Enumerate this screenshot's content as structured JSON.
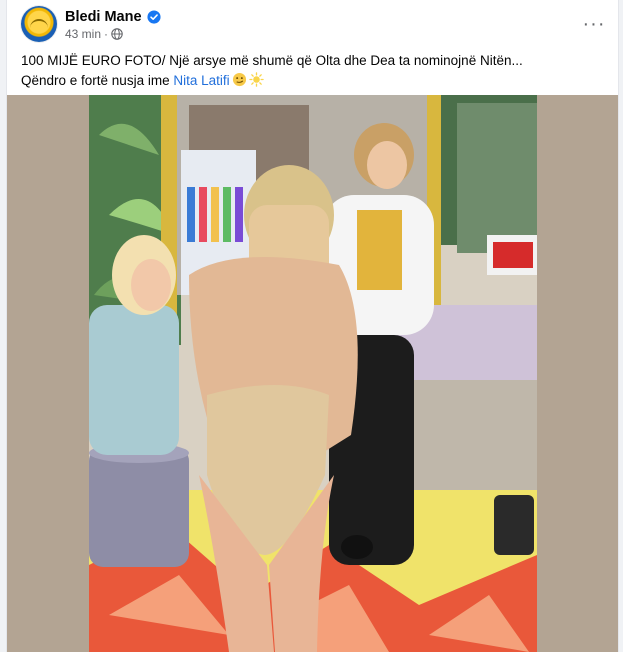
{
  "post": {
    "author": "Bledi Mane",
    "timestamp": "43 min",
    "separator": "·",
    "verified_icon": "verified-badge-icon",
    "privacy_icon": "globe-icon",
    "more_icon": "more-options-icon",
    "more_label": "···",
    "caption_line1": "100 MIJË EURO FOTO/ Një arsye më shumë që Olta dhe Dea ta nominojnë Nitën...",
    "caption_line2_prefix": "Qëndro e fortë nusja ime ",
    "mention": "Nita Latifi",
    "photo": "post-photo"
  },
  "colors": {
    "verified": "#1877f2",
    "mention": "#216fdb",
    "meta": "#65676b",
    "text": "#050505"
  }
}
